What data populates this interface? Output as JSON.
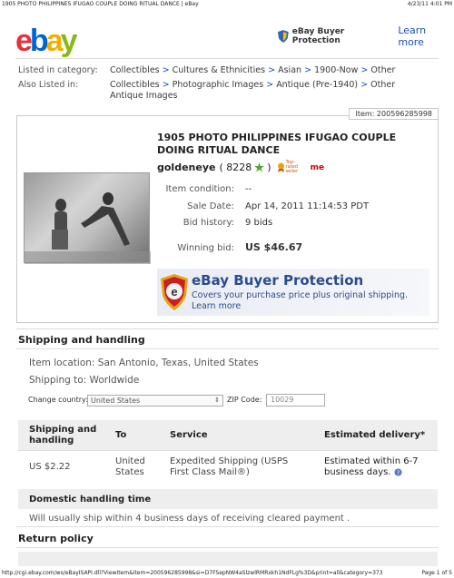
{
  "print_header": {
    "title": "1905 PHOTO PHILIPPINES IFUGAO COUPLE DOING RITUAL DANCE | eBay",
    "datetime": "4/23/11 4:01 PM"
  },
  "logo": {
    "letters": [
      "e",
      "b",
      "a",
      "y"
    ],
    "colors": [
      "#e53238",
      "#0064d2",
      "#f5af02",
      "#86b817"
    ]
  },
  "buyer_protection_top": {
    "brand": "eBay Buyer Protection",
    "link": "Learn more"
  },
  "categories": {
    "listed_label": "Listed in category:",
    "listed": [
      "Collectibles",
      "Cultures & Ethnicities",
      "Asian",
      "1900-Now",
      "Other"
    ],
    "also_label": "Also Listed in:",
    "also_line1": [
      "Collectibles",
      "Photographic Images",
      "Antique (Pre-1940)",
      "Other"
    ],
    "also_line2": "Antique Images",
    "separator": ">"
  },
  "item": {
    "number": "Item: 200596285998",
    "title_line1": "1905 PHOTO PHILIPPINES IFUGAO COUPLE",
    "title_line2": "DOING RITUAL DANCE",
    "seller": "goldeneye",
    "feedback": "( 8228",
    "feedback_close": ")",
    "top_rated": "Top-rated seller",
    "me_badge": "me",
    "condition_label": "Item condition:",
    "condition_value": "--",
    "sale_date_label": "Sale Date:",
    "sale_date_value": "Apr 14, 2011 11:14:53 PDT",
    "bid_history_label": "Bid history:",
    "bid_history_value": "9 bids",
    "winning_bid_label": "Winning bid:",
    "winning_bid_value": "US $46.67"
  },
  "bp_banner": {
    "heading": "eBay Buyer Protection",
    "line1": "Covers your purchase price plus original shipping.",
    "line2": "Learn more"
  },
  "shipping": {
    "section_title": "Shipping and handling",
    "location": "Item location: San Antonio, Texas, United States",
    "ship_to": "Shipping to: Worldwide",
    "change_country_label": "Change country:",
    "country_value": "United States",
    "zip_label": "ZIP Code:",
    "zip_value": "10029",
    "table_headers": [
      "Shipping and handling",
      "To",
      "Service",
      "Estimated delivery*"
    ],
    "row": {
      "cost": "US $2.22",
      "to": "United States",
      "service": "Expedited Shipping (USPS First Class Mail®)",
      "delivery": "Estimated within 6-7 business days."
    },
    "domestic_title": "Domestic handling time",
    "domestic_text": "Will usually ship within 4 business days of receiving cleared payment ."
  },
  "return_policy": {
    "title": "Return policy"
  },
  "print_footer": {
    "url": "http://cgi.ebay.com/ws/eBayISAPI.dll?ViewItem&item=200596285998&si=D7FSepNW4aSlzwlRMRxkh1NdFLg%3D&print=all&category=373",
    "page": "Page 1 of 5"
  }
}
